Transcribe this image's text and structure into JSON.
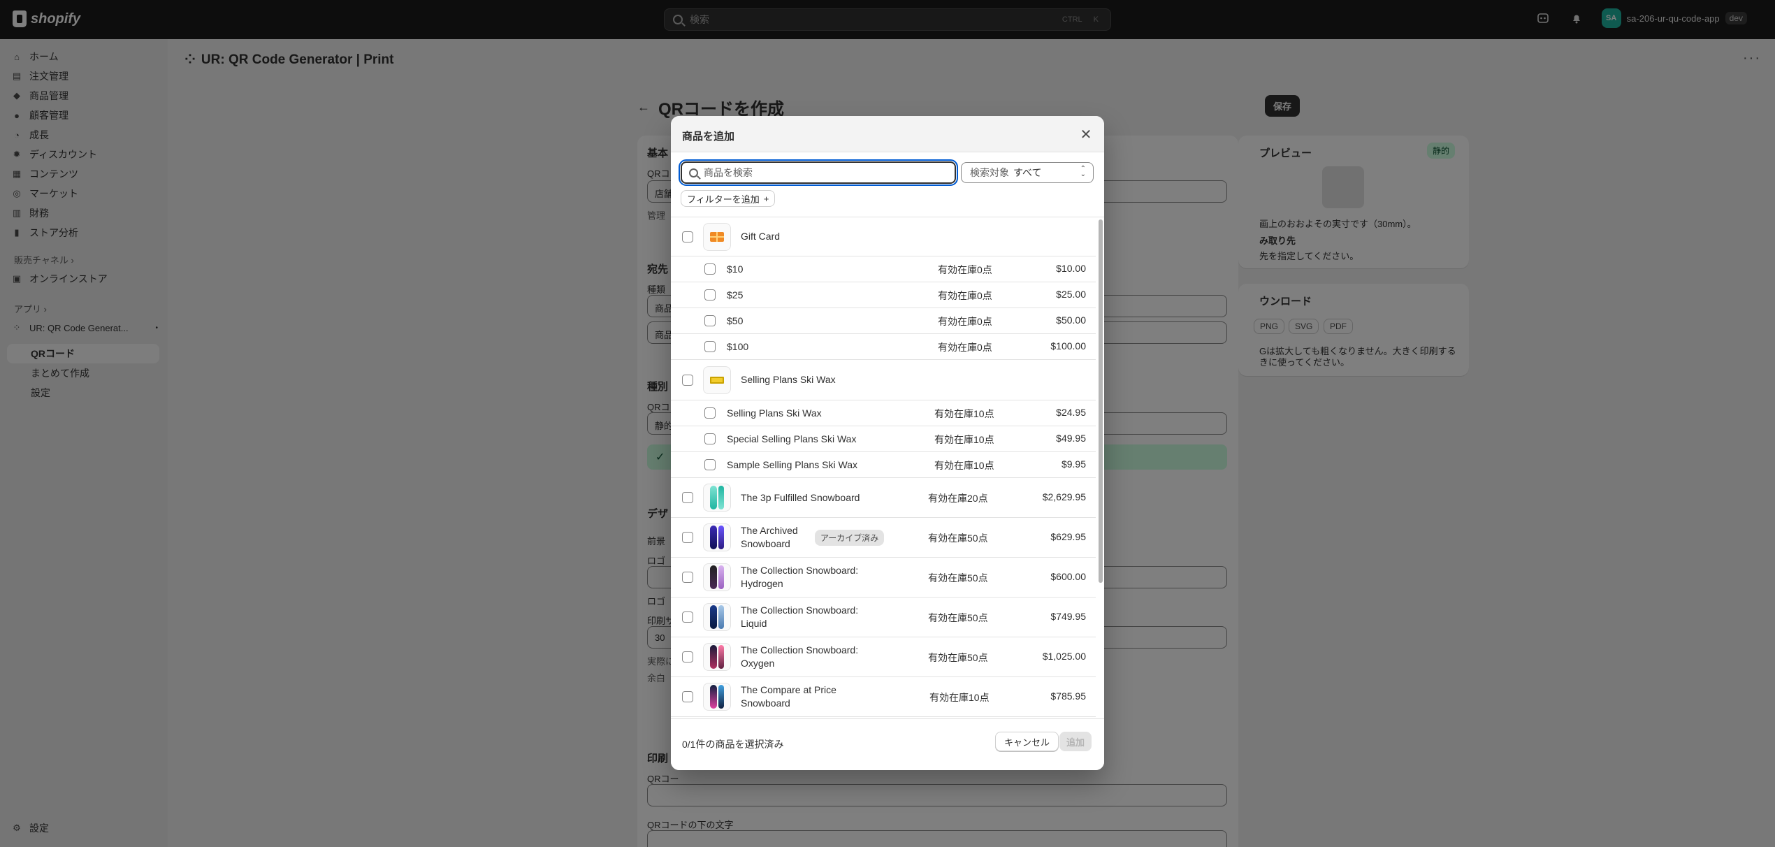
{
  "topbar": {
    "brand": "shopify",
    "search_placeholder": "検索",
    "kbd1": "CTRL",
    "kbd2": "K",
    "store_initials": "SA",
    "store_name": "sa-206-ur-qu-code-app",
    "env_badge": "dev"
  },
  "sidebar": {
    "items": [
      {
        "label": "ホーム",
        "icon": "home-icon"
      },
      {
        "label": "注文管理",
        "icon": "orders-icon"
      },
      {
        "label": "商品管理",
        "icon": "tag-icon"
      },
      {
        "label": "顧客管理",
        "icon": "person-icon"
      },
      {
        "label": "成長",
        "icon": "growth-icon"
      },
      {
        "label": "ディスカウント",
        "icon": "discount-icon"
      },
      {
        "label": "コンテンツ",
        "icon": "content-icon"
      },
      {
        "label": "マーケット",
        "icon": "globe-icon"
      },
      {
        "label": "財務",
        "icon": "bank-icon"
      },
      {
        "label": "ストア分析",
        "icon": "chart-icon"
      }
    ],
    "sales_channels": "販売チャネル",
    "online_store": "オンラインストア",
    "apps": "アプリ",
    "app_name": "UR: QR Code Generat...",
    "app_sub": [
      "QRコード",
      "まとめて作成",
      "設定"
    ],
    "settings": "設定"
  },
  "main": {
    "app_title": "UR: QR Code Generator | Print",
    "page_title": "QRコードを作成",
    "save": "保存",
    "bg_labels": {
      "basic": "基本",
      "qr_label": "QRコ",
      "store_field": "店舗",
      "manage": "管理",
      "dest": "宛先",
      "kind": "種類",
      "product_field": "商品",
      "product_field2": "商品",
      "type": "種別",
      "qr2": "QRコ",
      "static_field": "静的",
      "design": "デザ",
      "fg": "前景",
      "logo": "ロゴ",
      "logo2": "ロゴ",
      "print_size": "印刷サ",
      "size_val": "30",
      "actual": "実際に",
      "margin": "余白",
      "print": "印刷",
      "qr3": "QRコー",
      "below_text": "QRコードの下の文字",
      "preview": "プレビュー",
      "static_badge": "静的",
      "preview_note": "画上のおおよその実寸です（30mm）。",
      "scan_target": "み取り先",
      "scan_note": "先を指定してください。",
      "download": "ウンロード",
      "png": "PNG",
      "svg": "SVG",
      "pdf": "PDF",
      "download_note1": "Gは拡大しても粗くなりません。大きく印刷する",
      "download_note2": "きに使ってください。"
    }
  },
  "modal": {
    "title": "商品を追加",
    "search_placeholder": "商品を検索",
    "scope_label": "検索対象",
    "scope_value": "すべて",
    "filter_btn": "フィルターを追加",
    "groups": [
      {
        "name": "Gift Card",
        "variants": [
          {
            "name": "$10",
            "stock": "有効在庫0点",
            "price": "$10.00"
          },
          {
            "name": "$25",
            "stock": "有効在庫0点",
            "price": "$25.00"
          },
          {
            "name": "$50",
            "stock": "有効在庫0点",
            "price": "$50.00"
          },
          {
            "name": "$100",
            "stock": "有効在庫0点",
            "price": "$100.00"
          }
        ]
      },
      {
        "name": "Selling Plans Ski Wax",
        "variants": [
          {
            "name": "Selling Plans Ski Wax",
            "stock": "有効在庫10点",
            "price": "$24.95"
          },
          {
            "name": "Special Selling Plans Ski Wax",
            "stock": "有効在庫10点",
            "price": "$49.95"
          },
          {
            "name": "Sample Selling Plans Ski Wax",
            "stock": "有効在庫10点",
            "price": "$9.95"
          }
        ]
      }
    ],
    "products": [
      {
        "name1": "The 3p Fulfilled Snowboard",
        "name2": "",
        "stock": "有効在庫20点",
        "price": "$2,629.95",
        "badge": ""
      },
      {
        "name1": "The Archived",
        "name2": "Snowboard",
        "stock": "有効在庫50点",
        "price": "$629.95",
        "badge": "アーカイブ済み"
      },
      {
        "name1": "The Collection Snowboard:",
        "name2": "Hydrogen",
        "stock": "有効在庫50点",
        "price": "$600.00",
        "badge": ""
      },
      {
        "name1": "The Collection Snowboard:",
        "name2": "Liquid",
        "stock": "有効在庫50点",
        "price": "$749.95",
        "badge": ""
      },
      {
        "name1": "The Collection Snowboard:",
        "name2": "Oxygen",
        "stock": "有効在庫50点",
        "price": "$1,025.00",
        "badge": ""
      },
      {
        "name1": "The Compare at Price",
        "name2": "Snowboard",
        "stock": "有効在庫10点",
        "price": "$785.95",
        "badge": ""
      }
    ],
    "selected_count": "0/1件の商品を選択済み",
    "cancel": "キャンセル",
    "add": "追加"
  },
  "colors": {
    "accent": "#005bd3",
    "topbar": "#1a1a1a",
    "primary_btn": "#303030"
  }
}
